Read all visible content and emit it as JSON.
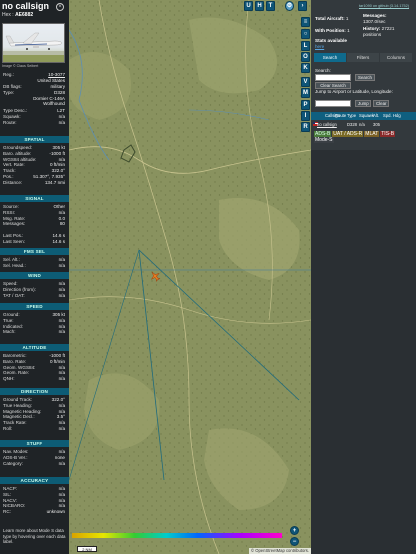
{
  "aircraft": {
    "callsign": "no callsign",
    "hex_label": "Hex :",
    "hex": "AE6882",
    "photo_caption": "Image © Claus Seibert",
    "details": [
      {
        "k": "Reg.:",
        "v": "10-3077"
      },
      {
        "k": "",
        "v": "United States"
      },
      {
        "k": "DB flags:",
        "v": "military"
      },
      {
        "k": "Type:",
        "v": "D328"
      }
    ],
    "type_desc": [
      "Dornier C-146A",
      "Wolfhound"
    ],
    "details2": [
      {
        "k": "Type Desc.:",
        "v": "L2T"
      },
      {
        "k": "Squawk:",
        "v": "n/a"
      },
      {
        "k": "Route:",
        "v": "n/a"
      }
    ]
  },
  "sections": {
    "spatial": "SPATIAL",
    "signal": "SIGNAL",
    "fms": "FMS SEL",
    "wind": "WIND",
    "speed": "SPEED",
    "altitude": "ALTITUDE",
    "direction": "DIRECTION",
    "stuff": "STUFF",
    "accuracy": "ACCURACY"
  },
  "spatial": [
    {
      "k": "Groundspeed:",
      "v": "305 kt"
    },
    {
      "k": "Baro. altitude:",
      "v": "-1000 ft"
    },
    {
      "k": "WGS84 altitude:",
      "v": "n/a"
    },
    {
      "k": "Vert. Rate:",
      "v": "0 ft/min"
    },
    {
      "k": "Track:",
      "v": "322.0°"
    },
    {
      "k": "Pos.:",
      "v": "51.307°, 7.935°"
    },
    {
      "k": "Distance:",
      "v": "134.7 nmi"
    }
  ],
  "signal": [
    {
      "k": "Source:",
      "v": "Other"
    },
    {
      "k": "RSSI:",
      "v": "n/a"
    },
    {
      "k": "Msg. Rate:",
      "v": "0.0"
    },
    {
      "k": "Messages:",
      "v": "80"
    },
    {
      "k": "",
      "v": ""
    },
    {
      "k": "Last Pos.:",
      "v": "14.6 s"
    },
    {
      "k": "Last Seen:",
      "v": "14.6 s"
    }
  ],
  "fms": [
    {
      "k": "Sel. Alt.:",
      "v": "n/a"
    },
    {
      "k": "Sel. Head.:",
      "v": "n/a"
    }
  ],
  "wind": [
    {
      "k": "Speed:",
      "v": "n/a"
    },
    {
      "k": "Direction (from):",
      "v": "n/a"
    },
    {
      "k": "TAT / OAT:",
      "v": "n/a"
    }
  ],
  "speed": [
    {
      "k": "Ground:",
      "v": "305 kt"
    },
    {
      "k": "True:",
      "v": "n/a"
    },
    {
      "k": "Indicated:",
      "v": "n/a"
    },
    {
      "k": "Mach:",
      "v": "n/a"
    }
  ],
  "altitude": [
    {
      "k": "Barometric:",
      "v": "-1000 ft"
    },
    {
      "k": "Baro. Rate:",
      "v": "0 ft/min"
    },
    {
      "k": "Geom. WGS84:",
      "v": "n/a"
    },
    {
      "k": "Geom. Rate:",
      "v": "n/a"
    },
    {
      "k": "QNH:",
      "v": "n/a"
    }
  ],
  "direction": [
    {
      "k": "Ground Track:",
      "v": "322.0°"
    },
    {
      "k": "True Heading:",
      "v": "n/a"
    },
    {
      "k": "Magnetic Heading:",
      "v": "n/a"
    },
    {
      "k": "Magnetic Decl.:",
      "v": "3.5°"
    },
    {
      "k": "Track Rate:",
      "v": "n/a"
    },
    {
      "k": "Roll:",
      "v": "n/a"
    }
  ],
  "stuff": [
    {
      "k": "Nav. Modes:",
      "v": "n/a"
    },
    {
      "k": "ADS-B Ver.:",
      "v": "none"
    },
    {
      "k": "Category:",
      "v": "n/a"
    }
  ],
  "accuracy": [
    {
      "k": "NACP:",
      "v": "n/a"
    },
    {
      "k": "SIL:",
      "v": "n/a"
    },
    {
      "k": "NACV:",
      "v": "n/a"
    },
    {
      "k": "NICBARO:",
      "v": "n/a"
    },
    {
      "k": "RC:",
      "v": "unknown"
    }
  ],
  "help_text": "Learn more about Mode S data type by hovering over each data label.",
  "map": {
    "top_buttons": [
      "U",
      "H",
      "T"
    ],
    "side_buttons": [
      "L",
      "O",
      "K",
      "V",
      "M",
      "P",
      "I",
      "R"
    ],
    "zoom_in": "+",
    "zoom_out": "−",
    "scale": "2 NM",
    "attribution": "© OpenStreetMap contributors."
  },
  "stats": {
    "link": "tar1090 on github (3.14.1752)",
    "total_label": "Total Aircraft:",
    "total": "1",
    "messages_label": "Messages:",
    "messages": "1307.0/sec",
    "withpos_label": "With Position:",
    "withpos": "1",
    "history_label": "History:",
    "history": "27221 positions",
    "stats_label": "Stats available",
    "stats_link": "here"
  },
  "tabs": [
    "Search",
    "Filters",
    "Columns"
  ],
  "search": {
    "label": "Search:",
    "button": "Search",
    "clear": "Clear Search",
    "jump_label": "Jump to Airport or Latitude, Longitude:",
    "jump_button": "Jump",
    "clear2": "Clear"
  },
  "table": {
    "headers": [
      "Callsign",
      "Route",
      "Type",
      "Squawk",
      "Alt.",
      "Spd.",
      "Hdg"
    ],
    "row": [
      "no callsign",
      "",
      "D328",
      "",
      "n/a",
      "",
      "305"
    ]
  },
  "legend": [
    {
      "label": "ADS-B",
      "color": "#4a7a3a"
    },
    {
      "label": "UAT / ADS-R",
      "color": "#7a6a25"
    },
    {
      "label": "MLAT",
      "color": "#7a6025"
    },
    {
      "label": "TIS-B",
      "color": "#8a2a2a"
    },
    {
      "label": "Mode-S",
      "color": "#3a3f44"
    }
  ]
}
